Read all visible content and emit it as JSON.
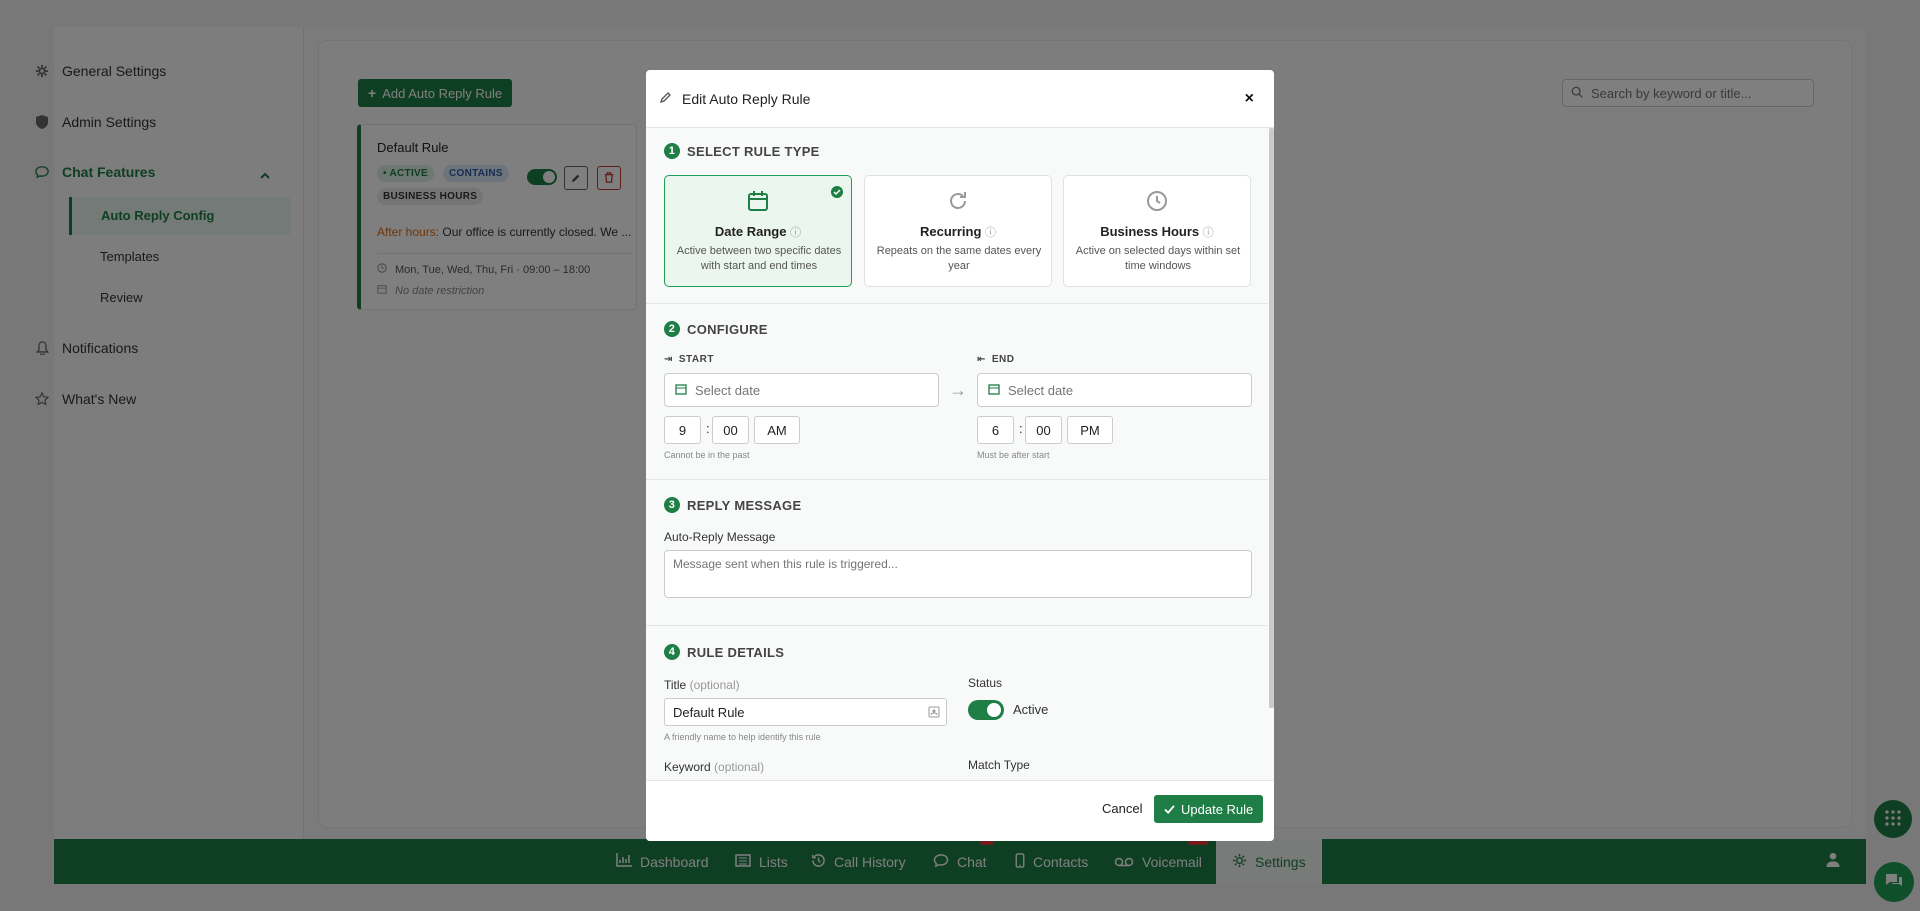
{
  "sidebar": {
    "items": [
      {
        "label": "General Settings",
        "icon": "gear-icon"
      },
      {
        "label": "Admin Settings",
        "icon": "shield-icon"
      },
      {
        "label": "Chat Features",
        "icon": "chat-bubble-icon"
      },
      {
        "label": "Notifications",
        "icon": "bell-icon"
      },
      {
        "label": "What's New",
        "icon": "star-icon"
      }
    ],
    "sub_items": [
      {
        "label": "Auto Reply Config"
      },
      {
        "label": "Templates"
      },
      {
        "label": "Review"
      }
    ]
  },
  "toolbar": {
    "add_label": "Add Auto Reply Rule",
    "search_placeholder": "Search by keyword or title..."
  },
  "rule_card": {
    "title": "Default Rule",
    "badge_active": "ACTIVE",
    "badge_contains": "CONTAINS",
    "badge_type": "BUSINESS HOURS",
    "message_label": "After hours:",
    "message_text": "Our office is currently closed. We ...",
    "schedule": "Mon, Tue, Wed, Thu, Fri · 09:00 – 18:00",
    "date_restriction": "No date restriction"
  },
  "modal": {
    "title": "Edit Auto Reply Rule",
    "close": "×",
    "sections": {
      "type": {
        "num": "1",
        "title": "SELECT RULE TYPE"
      },
      "configure": {
        "num": "2",
        "title": "CONFIGURE"
      },
      "reply": {
        "num": "3",
        "title": "REPLY MESSAGE"
      },
      "details": {
        "num": "4",
        "title": "RULE DETAILS"
      }
    },
    "rule_types": [
      {
        "name": "Date Range",
        "desc": "Active between two specific dates with start and end times",
        "selected": true
      },
      {
        "name": "Recurring",
        "desc": "Repeats on the same dates every year",
        "selected": false
      },
      {
        "name": "Business Hours",
        "desc": "Active on selected days within set time windows",
        "selected": false
      }
    ],
    "configure": {
      "start_label": "START",
      "end_label": "END",
      "date_placeholder": "Select date",
      "start_hour": "9",
      "start_minute": "00",
      "start_ampm": "AM",
      "end_hour": "6",
      "end_minute": "00",
      "end_ampm": "PM",
      "start_hint": "Cannot be in the past",
      "end_hint": "Must be after start"
    },
    "reply": {
      "label": "Auto-Reply Message",
      "placeholder": "Message sent when this rule is triggered..."
    },
    "details": {
      "title_label": "Title",
      "title_optional": "(optional)",
      "title_value": "Default Rule",
      "title_hint": "A friendly name to help identify this rule",
      "status_label": "Status",
      "status_value": "Active",
      "keyword_label": "Keyword",
      "keyword_optional": "(optional)",
      "match_type_label": "Match Type"
    },
    "footer": {
      "cancel": "Cancel",
      "update": "Update Rule"
    }
  },
  "bottom_nav": [
    {
      "label": "Dashboard",
      "icon": "bar-chart-icon"
    },
    {
      "label": "Lists",
      "icon": "list-icon"
    },
    {
      "label": "Call History",
      "icon": "history-icon"
    },
    {
      "label": "Chat",
      "icon": "chat-bubble-icon"
    },
    {
      "label": "Contacts",
      "icon": "phone-icon"
    },
    {
      "label": "Voicemail",
      "icon": "voicemail-icon"
    },
    {
      "label": "Settings",
      "icon": "gear-icon"
    }
  ],
  "colors": {
    "brand": "#1e7e45",
    "accent_orange": "#e06c10",
    "danger": "#c0392b"
  }
}
